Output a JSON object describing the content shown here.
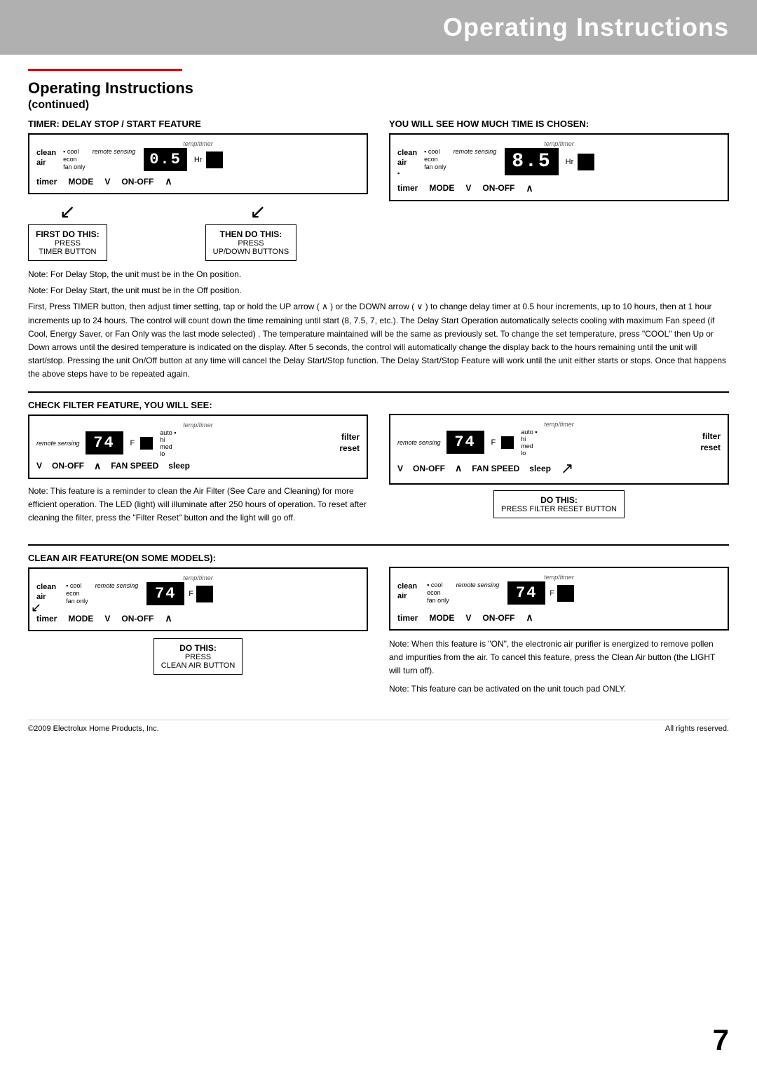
{
  "header": {
    "title": "Operating Instructions",
    "bg_color": "#b0b0b0"
  },
  "page_section": {
    "title": "Operating Instructions",
    "subtitle": "(continued)"
  },
  "timer_section": {
    "heading": "TIMER: DELAY STOP / START FEATURE",
    "left_panel": {
      "top_label": "temp/timer",
      "clean_air_lines": [
        "clean",
        "air"
      ],
      "mode_bullets": [
        "cool",
        "econ",
        "fan only"
      ],
      "remote_sensing": "remote sensing",
      "display_value": "0.5",
      "hr_label": "Hr",
      "timer_label": "timer",
      "mode_label": "MODE",
      "v_label": "V",
      "on_off_label": "ON-OFF",
      "caret_up": "∧"
    },
    "right_panel": {
      "top_label": "temp/timer",
      "clean_air_lines": [
        "clean",
        "air"
      ],
      "mode_bullets": [
        "cool",
        "econ",
        "fan only"
      ],
      "remote_sensing": "remote sensing",
      "display_value": "8.5",
      "hr_label": "Hr",
      "timer_label": "timer",
      "mode_label": "MODE",
      "v_label": "V",
      "on_off_label": "ON-OFF",
      "caret_up": "∧",
      "heading": "YOU WILL SEE HOW MUCH TIME IS CHOSEN:"
    },
    "first_box": {
      "title": "FIRST DO THIS:",
      "action": "PRESS",
      "detail": "TIMER BUTTON"
    },
    "then_box": {
      "title": "THEN DO THIS:",
      "action": "PRESS",
      "detail": "UP/DOWN BUTTONS"
    }
  },
  "timer_notes": [
    "Note: For Delay Stop, the unit must be in the On position.",
    "Note: For Delay Start, the unit must be in the Off position.",
    "First, Press TIMER button, then adjust timer setting, tap or hold the UP arrow ( ∧ ) or the DOWN arrow ( ∨ ) to change delay timer at 0.5 hour increments, up to 10 hours, then at 1 hour increments up to 24 hours. The control will count down the time remaining until start (8, 7.5, 7, etc.). The Delay Start Operation automatically selects cooling with maximum Fan speed (if Cool, Energy Saver, or Fan Only was the last mode selected) . The temperature maintained will be the same as previously set. To change the set temperature, press \"COOL\" then Up or Down arrows until the desired temperature is indicated on the display. After 5 seconds, the control will automatically change the display back to the hours remaining until the unit will start/stop. Pressing the unit On/Off button at any time will cancel the Delay Start/Stop function. The Delay Start/Stop Feature will work until the unit either starts or stops. Once that happens the above steps have to be repeated again."
  ],
  "check_filter_section": {
    "heading": "CHECK FILTER FEATURE, YOU WILL SEE:",
    "left_panel": {
      "top_label": "temp/timer",
      "remote_sensing": "remote sensing",
      "display_value": "74",
      "f_label": "F",
      "auto_label": "auto ▪",
      "fan_options": [
        "hi",
        "med",
        "lo"
      ],
      "filter_reset": "filter\nreset",
      "v_label": "V",
      "on_off_label": "ON-OFF",
      "caret_up": "∧",
      "fan_speed_label": "FAN SPEED",
      "sleep_label": "sleep"
    },
    "right_panel": {
      "top_label": "temp/timer",
      "remote_sensing": "remote sensing",
      "display_value": "74",
      "f_label": "F",
      "auto_label": "auto ▪",
      "fan_options": [
        "hi",
        "med",
        "lo"
      ],
      "filter_reset": "filter\nreset",
      "v_label": "V",
      "on_off_label": "ON-OFF",
      "caret_up": "∧",
      "fan_speed_label": "FAN SPEED",
      "sleep_label": "sleep",
      "do_this_label": "DO THIS:",
      "action": "PRESS FILTER RESET BUTTON"
    }
  },
  "filter_notes": [
    "Note: This feature is a reminder to clean the Air Filter (See Care and Cleaning) for more efficient operation. The LED (light) will illuminate after 250 hours of operation. To reset after cleaning the filter, press the \"Filter Reset\" button and the light will go off."
  ],
  "clean_air_section": {
    "heading": "CLEAN AIR FEATURE(on some models):",
    "left_panel": {
      "top_label": "temp/timer",
      "clean_air_lines": [
        "clean",
        "air"
      ],
      "mode_bullets": [
        "cool",
        "econ",
        "fan only"
      ],
      "remote_sensing": "remote sensing",
      "display_value": "74",
      "f_label": "F",
      "timer_label": "timer",
      "mode_label": "MODE",
      "v_label": "V",
      "on_off_label": "ON-OFF",
      "caret_up": "∧"
    },
    "right_panel": {
      "top_label": "temp/timer",
      "clean_air_lines": [
        "clean",
        "air"
      ],
      "mode_bullets": [
        "cool",
        "econ",
        "fan only"
      ],
      "remote_sensing": "remote sensing",
      "display_value": "74",
      "f_label": "F",
      "timer_label": "timer",
      "mode_label": "MODE",
      "v_label": "V",
      "on_off_label": "ON-OFF",
      "caret_up": "∧"
    },
    "do_this_box": {
      "label": "DO THIS:",
      "action": "PRESS",
      "detail": "CLEAN AIR BUTTON"
    }
  },
  "clean_air_notes": [
    "Note: When this feature is \"ON\", the electronic air purifier is energized to remove pollen and impurities from the air. To cancel this feature, press the Clean Air button (the LIGHT will turn off).",
    "Note: This feature can be activated on the unit touch pad ONLY."
  ],
  "footer": {
    "copyright": "©2009 Electrolux Home Products, Inc.",
    "rights": "All rights reserved.",
    "page_number": "7"
  }
}
